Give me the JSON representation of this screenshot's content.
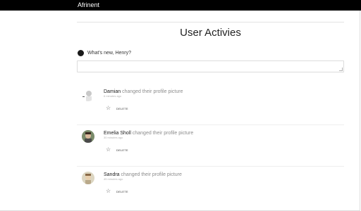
{
  "app": {
    "brand": "Afrinent"
  },
  "page": {
    "title": "User Activies"
  },
  "composer": {
    "prompt": "What's new, Henry?",
    "value": ""
  },
  "activities": [
    {
      "user": "Damian",
      "action": "changed their profile picture",
      "time": "6 minutes ago",
      "delete_label": "DELETE"
    },
    {
      "user": "Emelia Sholl",
      "action": "changed their profile picture",
      "time": "30 minutes ago",
      "delete_label": "DELETE"
    },
    {
      "user": "Sandra",
      "action": "changed their profile picture",
      "time": "45 minutes ago",
      "delete_label": "DELETE"
    }
  ],
  "icons": {
    "star": "star-outline-icon"
  }
}
